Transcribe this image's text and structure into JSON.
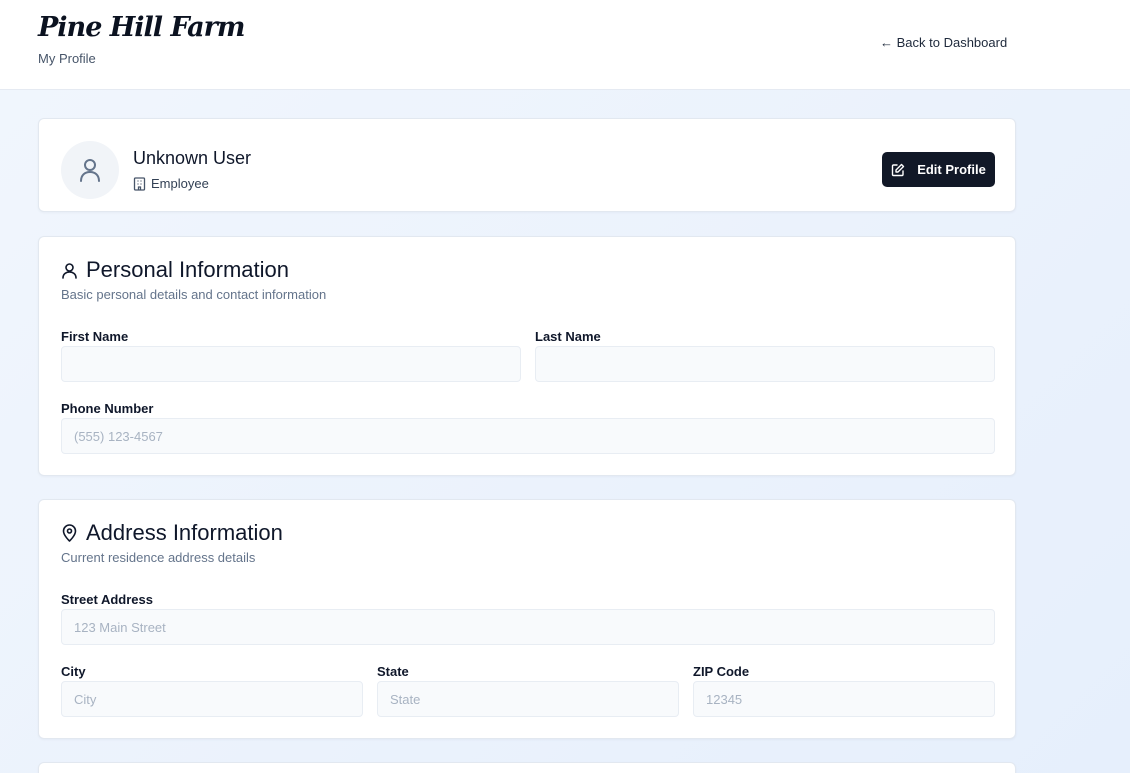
{
  "header": {
    "logo": "Pine Hill Farm",
    "subtitle": "My Profile",
    "back_link": "← Back to Dashboard"
  },
  "profile": {
    "name": "Unknown User",
    "role": "Employee",
    "edit_button": "Edit Profile",
    "avatar_icon": "user-icon",
    "role_icon": "building-icon",
    "edit_icon": "edit-icon"
  },
  "personal": {
    "title": "Personal Information",
    "description": "Basic personal details and contact information",
    "icon": "user-icon",
    "first_name": {
      "label": "First Name",
      "value": "",
      "placeholder": ""
    },
    "last_name": {
      "label": "Last Name",
      "value": "",
      "placeholder": ""
    },
    "phone": {
      "label": "Phone Number",
      "value": "",
      "placeholder": "(555) 123-4567"
    }
  },
  "address": {
    "title": "Address Information",
    "description": "Current residence address details",
    "icon": "map-pin-icon",
    "street": {
      "label": "Street Address",
      "value": "",
      "placeholder": "123 Main Street"
    },
    "city": {
      "label": "City",
      "value": "",
      "placeholder": "City"
    },
    "state": {
      "label": "State",
      "value": "",
      "placeholder": "State"
    },
    "zip": {
      "label": "ZIP Code",
      "value": "",
      "placeholder": "12345"
    }
  },
  "colors": {
    "primary_button": "#111827",
    "page_background": "#e9f1fc",
    "input_background": "#f8fafc"
  }
}
